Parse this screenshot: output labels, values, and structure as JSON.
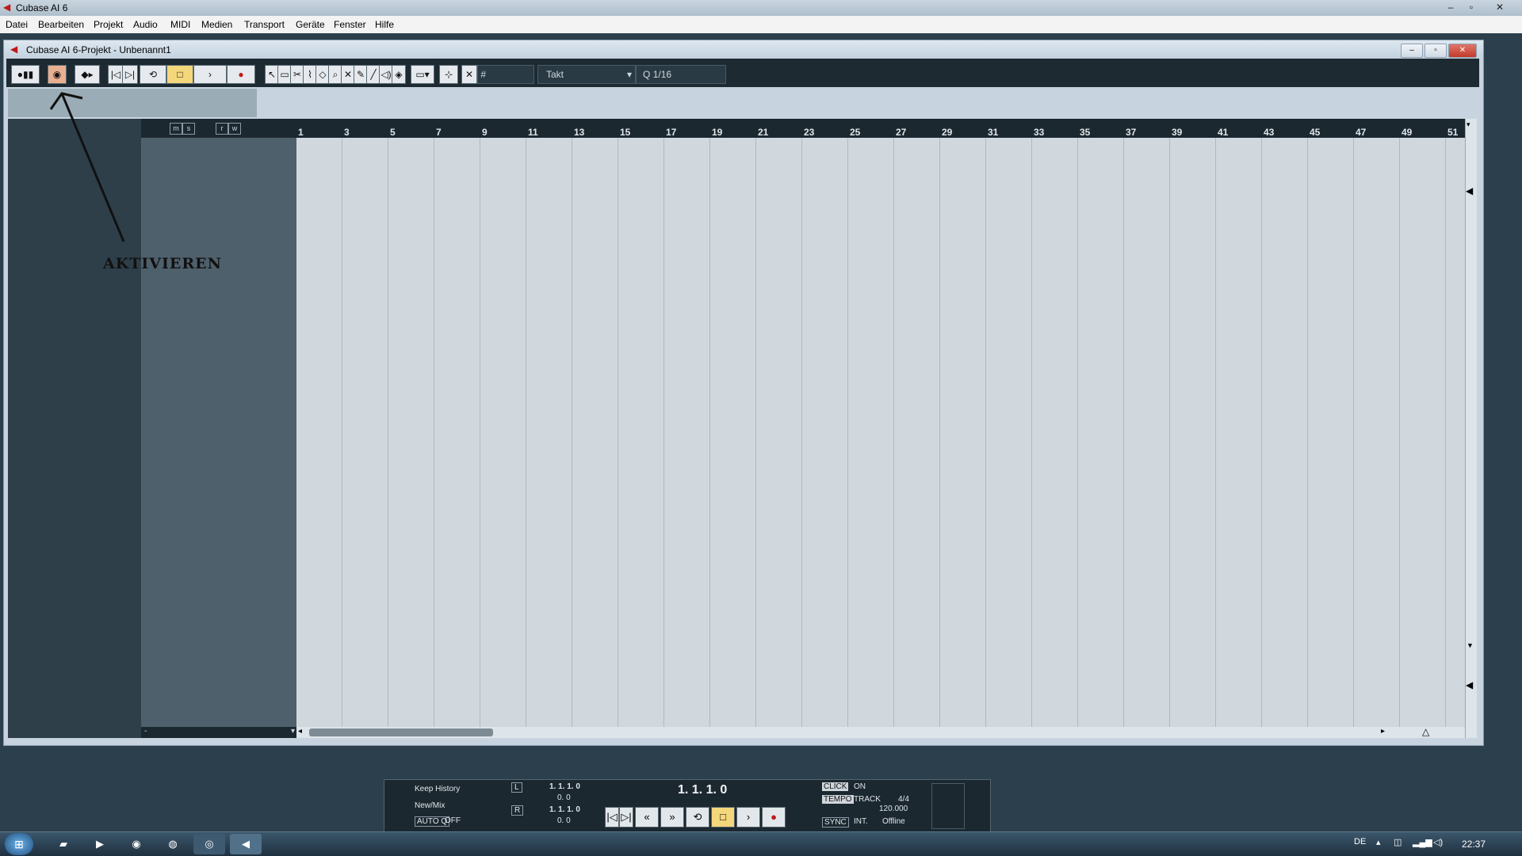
{
  "app": {
    "title": "Cubase AI 6"
  },
  "menu": [
    "Datei",
    "Bearbeiten",
    "Projekt",
    "Audio",
    "MIDI",
    "Medien",
    "Transport",
    "Geräte",
    "Fenster",
    "Hilfe"
  ],
  "project": {
    "title": "Cubase AI 6-Projekt - Unbenannt1"
  },
  "toolbar": {
    "snap_type": "Takt",
    "quantize": "1/16"
  },
  "tracklist": {
    "buttons": [
      "m",
      "s",
      "r",
      "w"
    ],
    "footer": "-"
  },
  "ruler": {
    "labels": [
      "1",
      "3",
      "5",
      "7",
      "9",
      "11",
      "13",
      "15",
      "17",
      "19",
      "21",
      "23",
      "25",
      "27",
      "29",
      "31",
      "33",
      "35",
      "37",
      "39",
      "41",
      "43",
      "45",
      "47",
      "49",
      "51"
    ]
  },
  "annotation": {
    "text": "AKTIVIEREN"
  },
  "transport": {
    "history": "Keep History",
    "mix": "New/Mix",
    "auto_q": "AUTO Q",
    "auto_q_state": "OFF",
    "left_locator": "1. 1. 1.   0",
    "left_locator_sub": "0.   0",
    "right_locator": "1. 1. 1.   0",
    "right_locator_sub": "0.   0",
    "position": "1. 1. 1.   0",
    "click_label": "CLICK",
    "click_state": "ON",
    "tempo_label": "TEMPO",
    "tempo_mode": "TRACK",
    "signature": "4/4",
    "tempo_value": "120.000",
    "sync_label": "SYNC",
    "sync_source": "INT.",
    "sync_state": "Offline",
    "marker_l": "L",
    "marker_r": "R"
  },
  "taskbar": {
    "language": "DE",
    "time": "22:37"
  }
}
